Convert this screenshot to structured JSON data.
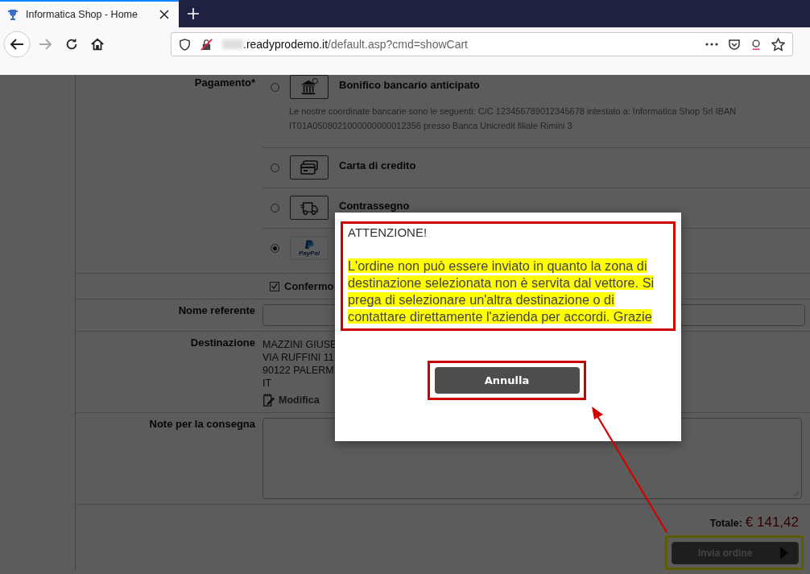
{
  "browser": {
    "tab_title": "Informatica Shop - Home",
    "url_host": ".readyprodemo.it",
    "url_path": "/default.asp?cmd=showCart"
  },
  "payment": {
    "label": "Pagamento*",
    "options": [
      {
        "kind": "bank",
        "name": "Bonifico bancario anticipato",
        "description": "Le nostre coordinate bancarie sono le seguenti: C/C 123456789012345678 intestato a: Informatica Shop Srl IBAN IT01A0508021000000000012356 presso Banca Unicredit filiale Rimini 3",
        "selected": false
      },
      {
        "kind": "card",
        "name": "Carta di credito",
        "selected": false
      },
      {
        "kind": "truck",
        "name": "Contrassegno",
        "selected": false
      },
      {
        "kind": "paypal",
        "logo_text": "PayPal",
        "selected": true
      }
    ]
  },
  "confirm": {
    "label": "Confermo",
    "checked": true
  },
  "contact_name": {
    "label": "Nome referente"
  },
  "destination": {
    "label": "Destinazione",
    "lines": [
      "MAZZINI GIUSE",
      "VIA RUFFINI 11",
      "90122 PALERM",
      "IT"
    ],
    "edit_link": "Modifica"
  },
  "notes": {
    "label": "Note per la consegna"
  },
  "total": {
    "label": "Totale:",
    "value": "€ 141,42"
  },
  "submit_button": "Invia ordine",
  "dialog": {
    "title": "ATTENZIONE!",
    "message": "L'ordine non può essere inviato in quanto la zona di destinazione selezionata non è servita dal vettore. Si prega di selezionare un'altra destinazione o di contattare direttamente l'azienda per accordi. Grazie",
    "button": "Annulla"
  }
}
